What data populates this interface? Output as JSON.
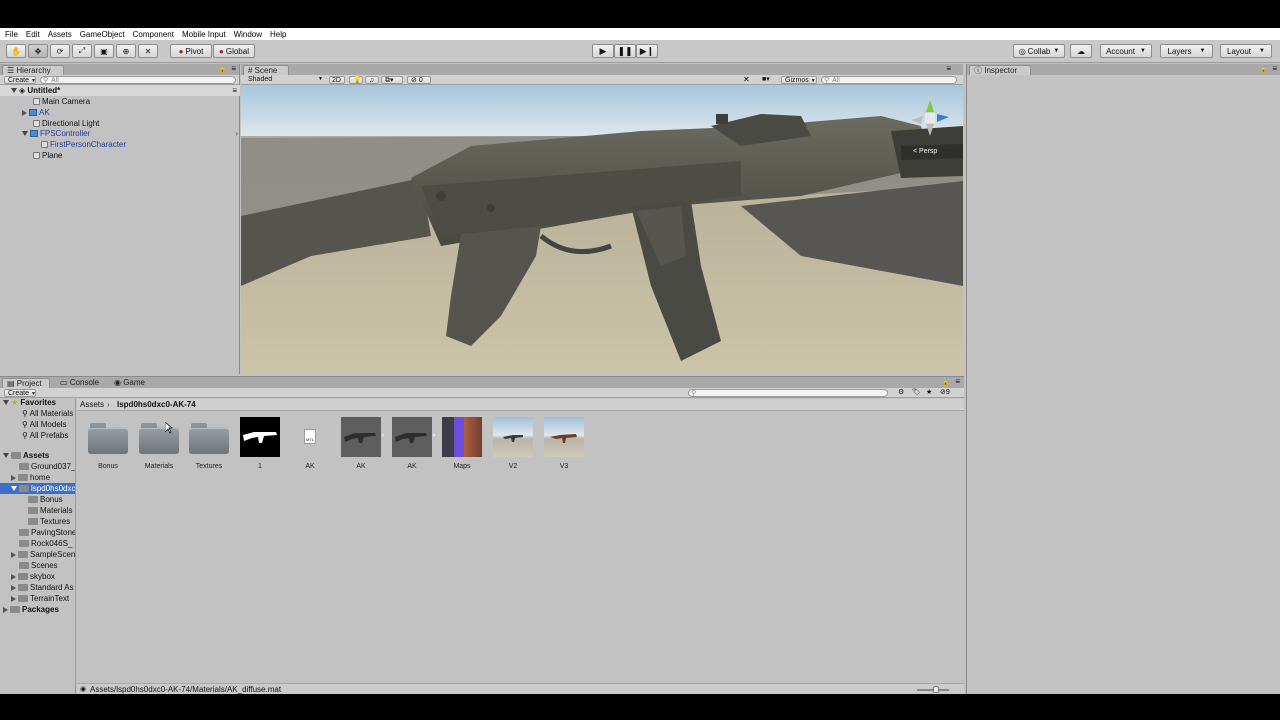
{
  "menu": [
    "File",
    "Edit",
    "Assets",
    "GameObject",
    "Component",
    "Mobile Input",
    "Window",
    "Help"
  ],
  "toolbar": {
    "pivot": "Pivot",
    "global": "Global",
    "collab": "Collab",
    "account": "Account",
    "layers": "Layers",
    "layout": "Layout"
  },
  "hierarchy": {
    "tab": "Hierarchy",
    "create": "Create",
    "search_placeholder": "All",
    "scene": "Untitled*",
    "items": [
      "Main Camera",
      "AK",
      "Directional Light",
      "FPSController",
      "FirstPersonCharacter",
      "Plane"
    ]
  },
  "scene": {
    "tab": "Scene",
    "shading": "Shaded",
    "mode2d": "2D",
    "fx_count": "0",
    "gizmos": "Gizmos",
    "search_placeholder": "All",
    "persp": "< Persp"
  },
  "inspector": {
    "tab": "Inspector"
  },
  "bottom_tabs": [
    "Project",
    "Console",
    "Game"
  ],
  "project": {
    "create": "Create",
    "favorites": "Favorites",
    "favorites_items": [
      "All Materials",
      "All Models",
      "All Prefabs"
    ],
    "assets_root": "Assets",
    "assets_items": [
      "Ground037_",
      "home",
      "lspd0hs0dxc",
      "Bonus",
      "Materials",
      "Textures",
      "PavingStone",
      "Rock046S_",
      "SampleScen",
      "Scenes",
      "skybox",
      "Standard As",
      "TerrainText"
    ],
    "packages": "Packages",
    "breadcrumb_root": "Assets",
    "breadcrumb_current": "lspd0hs0dxc0-AK-74",
    "asset_labels": [
      "Bonus",
      "Materials",
      "Textures",
      "1",
      "AK",
      "AK",
      "AK",
      "Maps",
      "V2",
      "V3"
    ],
    "mtl_badge": "MTL",
    "status_path": "Assets/lspd0hs0dxc0-AK-74/Materials/AK_diffuse.mat"
  },
  "colors": {
    "selection_blue": "#3d6fc4",
    "prefab_blue": "#1e3d9c",
    "panel_gray": "#c2c2c2"
  }
}
